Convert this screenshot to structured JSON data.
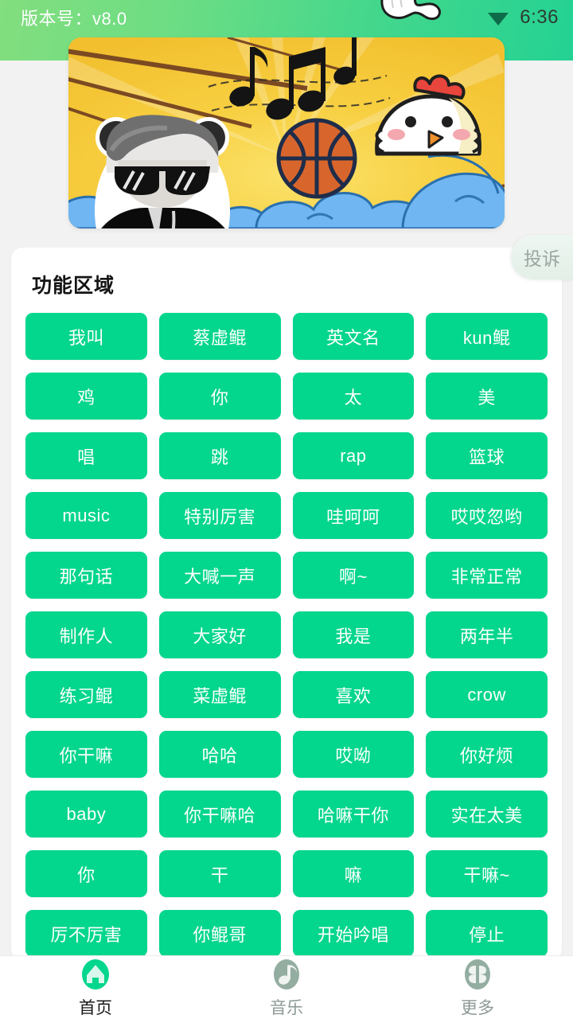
{
  "statusbar": {
    "version_label": "版本号：v8.0",
    "clock": "6:36",
    "wifi_icon": "wifi-icon",
    "notch_icon": "hand-cutout-icon",
    "gradient_left": "#82de7e",
    "gradient_right": "#24d293"
  },
  "banner": {
    "name": "promo-banner",
    "alt": "panda-head-meme-basketball-chicken-music-notes",
    "background_color": "#f5c63a",
    "wave_color": "#5aa9ec",
    "basketball_color": "#d8662c",
    "chicken_comb_color": "#e8453c"
  },
  "complaint": {
    "label": "投诉"
  },
  "card": {
    "title": "功能区域",
    "accent_color": "#03d68d",
    "buttons": [
      "我叫",
      "蔡虚鲲",
      "英文名",
      "kun鲲",
      "鸡",
      "你",
      "太",
      "美",
      "唱",
      "跳",
      "rap",
      "篮球",
      "music",
      "特别厉害",
      "哇呵呵",
      "哎哎忽哟",
      "那句话",
      "大喊一声",
      "啊~",
      "非常正常",
      "制作人",
      "大家好",
      "我是",
      "两年半",
      "练习鲲",
      "菜虚鲲",
      "喜欢",
      "crow",
      "你干嘛",
      "哈哈",
      "哎呦",
      "你好烦",
      "baby",
      "你干嘛哈",
      "哈嘛干你",
      "实在太美",
      "你",
      "干",
      "嘛",
      "干嘛~",
      "厉不厉害",
      "你鲲哥",
      "开始吟唱",
      "停止"
    ]
  },
  "tabbar": {
    "items": [
      {
        "label": "首页",
        "icon": "home-icon",
        "active": true,
        "color": "#03d68d"
      },
      {
        "label": "音乐",
        "icon": "music-note-icon",
        "active": false,
        "color": "#93ada1"
      },
      {
        "label": "更多",
        "icon": "grid-more-icon",
        "active": false,
        "color": "#93ada1"
      }
    ]
  }
}
